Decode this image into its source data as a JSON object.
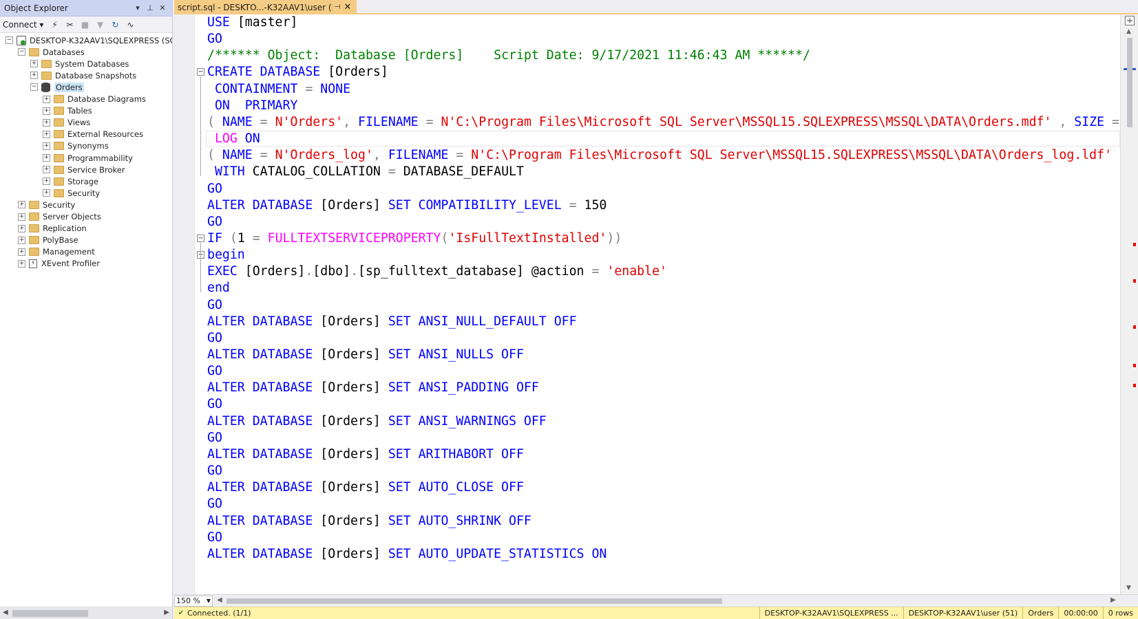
{
  "object_explorer": {
    "title": "Object Explorer",
    "pin_symbol": "▾ ⊥",
    "close_symbol": "✕",
    "connect_label": "Connect ▾",
    "tree": [
      {
        "label": "DESKTOP-K32AAV1\\SQLEXPRESS (SQL",
        "expander": "−",
        "icon": "server-icon",
        "level": 0
      },
      {
        "label": "Databases",
        "expander": "−",
        "icon": "folder-icon",
        "level": 1
      },
      {
        "label": "System Databases",
        "expander": "+",
        "icon": "folder-icon",
        "level": 2
      },
      {
        "label": "Database Snapshots",
        "expander": "+",
        "icon": "folder-icon",
        "level": 2
      },
      {
        "label": "Orders",
        "expander": "−",
        "icon": "database-icon",
        "level": 2,
        "selected": true
      },
      {
        "label": "Database Diagrams",
        "expander": "+",
        "icon": "folder-icon",
        "level": 3
      },
      {
        "label": "Tables",
        "expander": "+",
        "icon": "folder-icon",
        "level": 3
      },
      {
        "label": "Views",
        "expander": "+",
        "icon": "folder-icon",
        "level": 3
      },
      {
        "label": "External Resources",
        "expander": "+",
        "icon": "folder-icon",
        "level": 3
      },
      {
        "label": "Synonyms",
        "expander": "+",
        "icon": "folder-icon",
        "level": 3
      },
      {
        "label": "Programmability",
        "expander": "+",
        "icon": "folder-icon",
        "level": 3
      },
      {
        "label": "Service Broker",
        "expander": "+",
        "icon": "folder-icon",
        "level": 3
      },
      {
        "label": "Storage",
        "expander": "+",
        "icon": "folder-icon",
        "level": 3
      },
      {
        "label": "Security",
        "expander": "+",
        "icon": "folder-icon",
        "level": 3
      },
      {
        "label": "Security",
        "expander": "+",
        "icon": "folder-icon",
        "level": 1
      },
      {
        "label": "Server Objects",
        "expander": "+",
        "icon": "folder-icon",
        "level": 1
      },
      {
        "label": "Replication",
        "expander": "+",
        "icon": "folder-icon",
        "level": 1
      },
      {
        "label": "PolyBase",
        "expander": "+",
        "icon": "folder-icon",
        "level": 1
      },
      {
        "label": "Management",
        "expander": "+",
        "icon": "folder-icon",
        "level": 1
      },
      {
        "label": "XEvent Profiler",
        "expander": "+",
        "icon": "xevent-icon",
        "level": 1
      }
    ]
  },
  "editor": {
    "tab_title": "script.sql - DESKTO...-K32AAV1\\user (51))",
    "zoom": "150 %",
    "code_lines": [
      [
        [
          "kw",
          "USE "
        ],
        [
          "tx",
          "[master]"
        ]
      ],
      [
        [
          "kw",
          "GO"
        ]
      ],
      [
        [
          "cm",
          "/****** Object:  Database [Orders]    Script Date: 9/17/2021 11:46:43 AM ******/"
        ]
      ],
      [
        [
          "kw",
          "CREATE DATABASE "
        ],
        [
          "tx",
          "[Orders]"
        ]
      ],
      [
        [
          "tx",
          " "
        ],
        [
          "kw",
          "CONTAINMENT "
        ],
        [
          "op",
          "= "
        ],
        [
          "kw",
          "NONE"
        ]
      ],
      [
        [
          "tx",
          " "
        ],
        [
          "kw",
          "ON  PRIMARY"
        ]
      ],
      [
        [
          "op",
          "( "
        ],
        [
          "kw",
          "NAME "
        ],
        [
          "op",
          "= "
        ],
        [
          "str",
          "N'Orders'"
        ],
        [
          "op",
          ", "
        ],
        [
          "kw",
          "FILENAME "
        ],
        [
          "op",
          "= "
        ],
        [
          "str",
          "N'C:\\Program Files\\Microsoft SQL Server\\MSSQL15.SQLEXPRESS\\MSSQL\\DATA\\Orders.mdf'"
        ],
        [
          "tx",
          " "
        ],
        [
          "op",
          ", "
        ],
        [
          "kw",
          "SIZE "
        ],
        [
          "op",
          "= "
        ],
        [
          "tx",
          "8"
        ]
      ],
      [
        [
          "tx",
          " "
        ],
        [
          "fn",
          "LOG"
        ],
        [
          "tx",
          " "
        ],
        [
          "kw",
          "ON"
        ]
      ],
      [
        [
          "op",
          "( "
        ],
        [
          "kw",
          "NAME "
        ],
        [
          "op",
          "= "
        ],
        [
          "str",
          "N'Orders_log'"
        ],
        [
          "op",
          ", "
        ],
        [
          "kw",
          "FILENAME "
        ],
        [
          "op",
          "= "
        ],
        [
          "str",
          "N'C:\\Program Files\\Microsoft SQL Server\\MSSQL15.SQLEXPRESS\\MSSQL\\DATA\\Orders_log.ldf'"
        ],
        [
          "tx",
          " "
        ],
        [
          "op",
          ","
        ]
      ],
      [
        [
          "tx",
          " "
        ],
        [
          "kw",
          "WITH "
        ],
        [
          "tx",
          "CATALOG_COLLATION "
        ],
        [
          "op",
          "= "
        ],
        [
          "tx",
          "DATABASE_DEFAULT"
        ]
      ],
      [
        [
          "kw",
          "GO"
        ]
      ],
      [
        [
          "kw",
          "ALTER DATABASE "
        ],
        [
          "tx",
          "[Orders] "
        ],
        [
          "kw",
          "SET COMPATIBILITY_LEVEL "
        ],
        [
          "op",
          "= "
        ],
        [
          "tx",
          "150"
        ]
      ],
      [
        [
          "kw",
          "GO"
        ]
      ],
      [
        [
          "kw",
          "IF "
        ],
        [
          "op",
          "("
        ],
        [
          "tx",
          "1 "
        ],
        [
          "op",
          "= "
        ],
        [
          "fn",
          "FULLTEXTSERVICEPROPERTY"
        ],
        [
          "op",
          "("
        ],
        [
          "str",
          "'IsFullTextInstalled'"
        ],
        [
          "op",
          "))"
        ]
      ],
      [
        [
          "kw",
          "begin"
        ]
      ],
      [
        [
          "kw",
          "EXEC "
        ],
        [
          "tx",
          "[Orders]"
        ],
        [
          "op",
          "."
        ],
        [
          "tx",
          "[dbo]"
        ],
        [
          "op",
          "."
        ],
        [
          "tx",
          "[sp_fulltext_database] @action "
        ],
        [
          "op",
          "= "
        ],
        [
          "str",
          "'enable'"
        ]
      ],
      [
        [
          "kw",
          "end"
        ]
      ],
      [
        [
          "kw",
          "GO"
        ]
      ],
      [
        [
          "kw",
          "ALTER DATABASE "
        ],
        [
          "tx",
          "[Orders] "
        ],
        [
          "kw",
          "SET ANSI_NULL_DEFAULT OFF"
        ]
      ],
      [
        [
          "kw",
          "GO"
        ]
      ],
      [
        [
          "kw",
          "ALTER DATABASE "
        ],
        [
          "tx",
          "[Orders] "
        ],
        [
          "kw",
          "SET ANSI_NULLS OFF"
        ]
      ],
      [
        [
          "kw",
          "GO"
        ]
      ],
      [
        [
          "kw",
          "ALTER DATABASE "
        ],
        [
          "tx",
          "[Orders] "
        ],
        [
          "kw",
          "SET ANSI_PADDING OFF"
        ]
      ],
      [
        [
          "kw",
          "GO"
        ]
      ],
      [
        [
          "kw",
          "ALTER DATABASE "
        ],
        [
          "tx",
          "[Orders] "
        ],
        [
          "kw",
          "SET ANSI_WARNINGS OFF"
        ]
      ],
      [
        [
          "kw",
          "GO"
        ]
      ],
      [
        [
          "kw",
          "ALTER DATABASE "
        ],
        [
          "tx",
          "[Orders] "
        ],
        [
          "kw",
          "SET ARITHABORT OFF"
        ]
      ],
      [
        [
          "kw",
          "GO"
        ]
      ],
      [
        [
          "kw",
          "ALTER DATABASE "
        ],
        [
          "tx",
          "[Orders] "
        ],
        [
          "kw",
          "SET AUTO_CLOSE OFF"
        ]
      ],
      [
        [
          "kw",
          "GO"
        ]
      ],
      [
        [
          "kw",
          "ALTER DATABASE "
        ],
        [
          "tx",
          "[Orders] "
        ],
        [
          "kw",
          "SET AUTO_SHRINK OFF"
        ]
      ],
      [
        [
          "kw",
          "GO"
        ]
      ],
      [
        [
          "kw",
          "ALTER DATABASE "
        ],
        [
          "tx",
          "[Orders] "
        ],
        [
          "kw",
          "SET AUTO_UPDATE_STATISTICS ON"
        ]
      ]
    ],
    "syntax_colors": {
      "kw": "#0000ff",
      "str": "#e00000",
      "cm": "#008000",
      "op": "#808080",
      "tx": "#000000",
      "fn": "#ff00ff"
    }
  },
  "status_bar": {
    "connection": "Connected. (1/1)",
    "server": "DESKTOP-K32AAV1\\SQLEXPRESS ...",
    "user": "DESKTOP-K32AAV1\\user (51)",
    "database": "Orders",
    "elapsed": "00:00:00",
    "rows": "0 rows",
    "color": "#fff3a8"
  }
}
